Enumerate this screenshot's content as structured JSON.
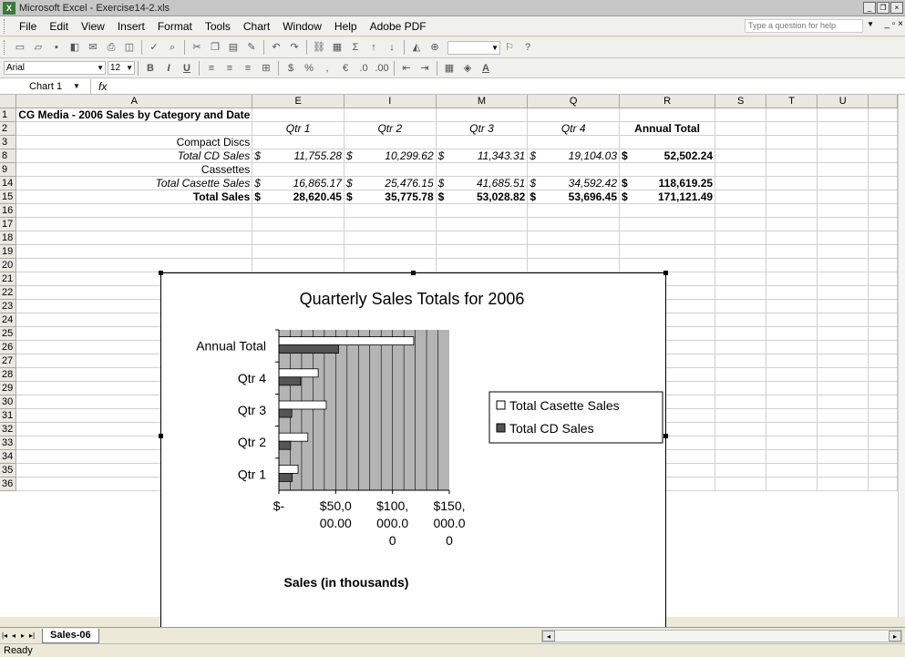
{
  "window": {
    "title": "Microsoft Excel - Exercise14-2.xls",
    "icon": "excel-app-icon"
  },
  "menu": [
    "File",
    "Edit",
    "View",
    "Insert",
    "Format",
    "Tools",
    "Chart",
    "Window",
    "Help",
    "Adobe PDF"
  ],
  "help_box": {
    "placeholder": "Type a question for help"
  },
  "formatting": {
    "font": "Arial",
    "size": "12"
  },
  "name_box": "Chart 1",
  "fx_label": "fx",
  "columns": [
    "A",
    "E",
    "I",
    "M",
    "Q",
    "R",
    "S",
    "T",
    "U"
  ],
  "rows": {
    "r1": {
      "num": "1",
      "a": "CG Media -  2006 Sales by Category and Date"
    },
    "r2": {
      "num": "2",
      "e": "Qtr 1",
      "i": "Qtr 2",
      "m": "Qtr 3",
      "q": "Qtr 4",
      "r": "Annual Total"
    },
    "r3": {
      "num": "3",
      "a": "Compact Discs"
    },
    "r8": {
      "num": "8",
      "a": "Total CD Sales",
      "cur": "$",
      "e": "11,755.28",
      "i": "10,299.62",
      "m": "11,343.31",
      "q": "19,104.03",
      "r": "52,502.24"
    },
    "r9": {
      "num": "9",
      "a": "Cassettes"
    },
    "r14": {
      "num": "14",
      "a": "Total Casette Sales",
      "cur": "$",
      "e": "16,865.17",
      "i": "25,476.15",
      "m": "41,685.51",
      "q": "34,592.42",
      "r": "118,619.25"
    },
    "r15": {
      "num": "15",
      "a": "Total Sales",
      "cur": "$",
      "e": "28,620.45",
      "i": "35,775.78",
      "m": "53,028.82",
      "q": "53,696.45",
      "r": "171,121.49"
    },
    "blank_rows": [
      "16",
      "17",
      "18",
      "19",
      "20",
      "21",
      "22",
      "23",
      "24",
      "25",
      "26",
      "27",
      "28",
      "29",
      "30",
      "31",
      "32",
      "33",
      "34",
      "35",
      "36"
    ]
  },
  "chart_data": {
    "type": "bar",
    "orientation": "horizontal",
    "title": "Quarterly Sales Totals for 2006",
    "xlabel": "Sales (in thousands)",
    "ylabel": "",
    "categories": [
      "Qtr 1",
      "Qtr 2",
      "Qtr 3",
      "Qtr 4",
      "Annual Total"
    ],
    "series": [
      {
        "name": "Total Casette Sales",
        "color": "#ffffff",
        "values": [
          16865.17,
          25476.15,
          41685.51,
          34592.42,
          118619.25
        ]
      },
      {
        "name": "Total CD Sales",
        "color": "#555555",
        "values": [
          11755.28,
          10299.62,
          11343.31,
          19104.03,
          52502.24
        ]
      }
    ],
    "xlim": [
      0,
      150000
    ],
    "x_ticks": [
      {
        "value": 0,
        "lines": [
          "$-"
        ]
      },
      {
        "value": 50000,
        "lines": [
          "$50,0",
          "00.00"
        ]
      },
      {
        "value": 100000,
        "lines": [
          "$100,",
          "000.0",
          "0"
        ]
      },
      {
        "value": 150000,
        "lines": [
          "$150,",
          "000.0",
          "0"
        ]
      }
    ],
    "plot_area_color": "#b4b4b4",
    "grid": true,
    "legend_position": "right"
  },
  "sheet_tab": "Sales-06",
  "status": "Ready"
}
